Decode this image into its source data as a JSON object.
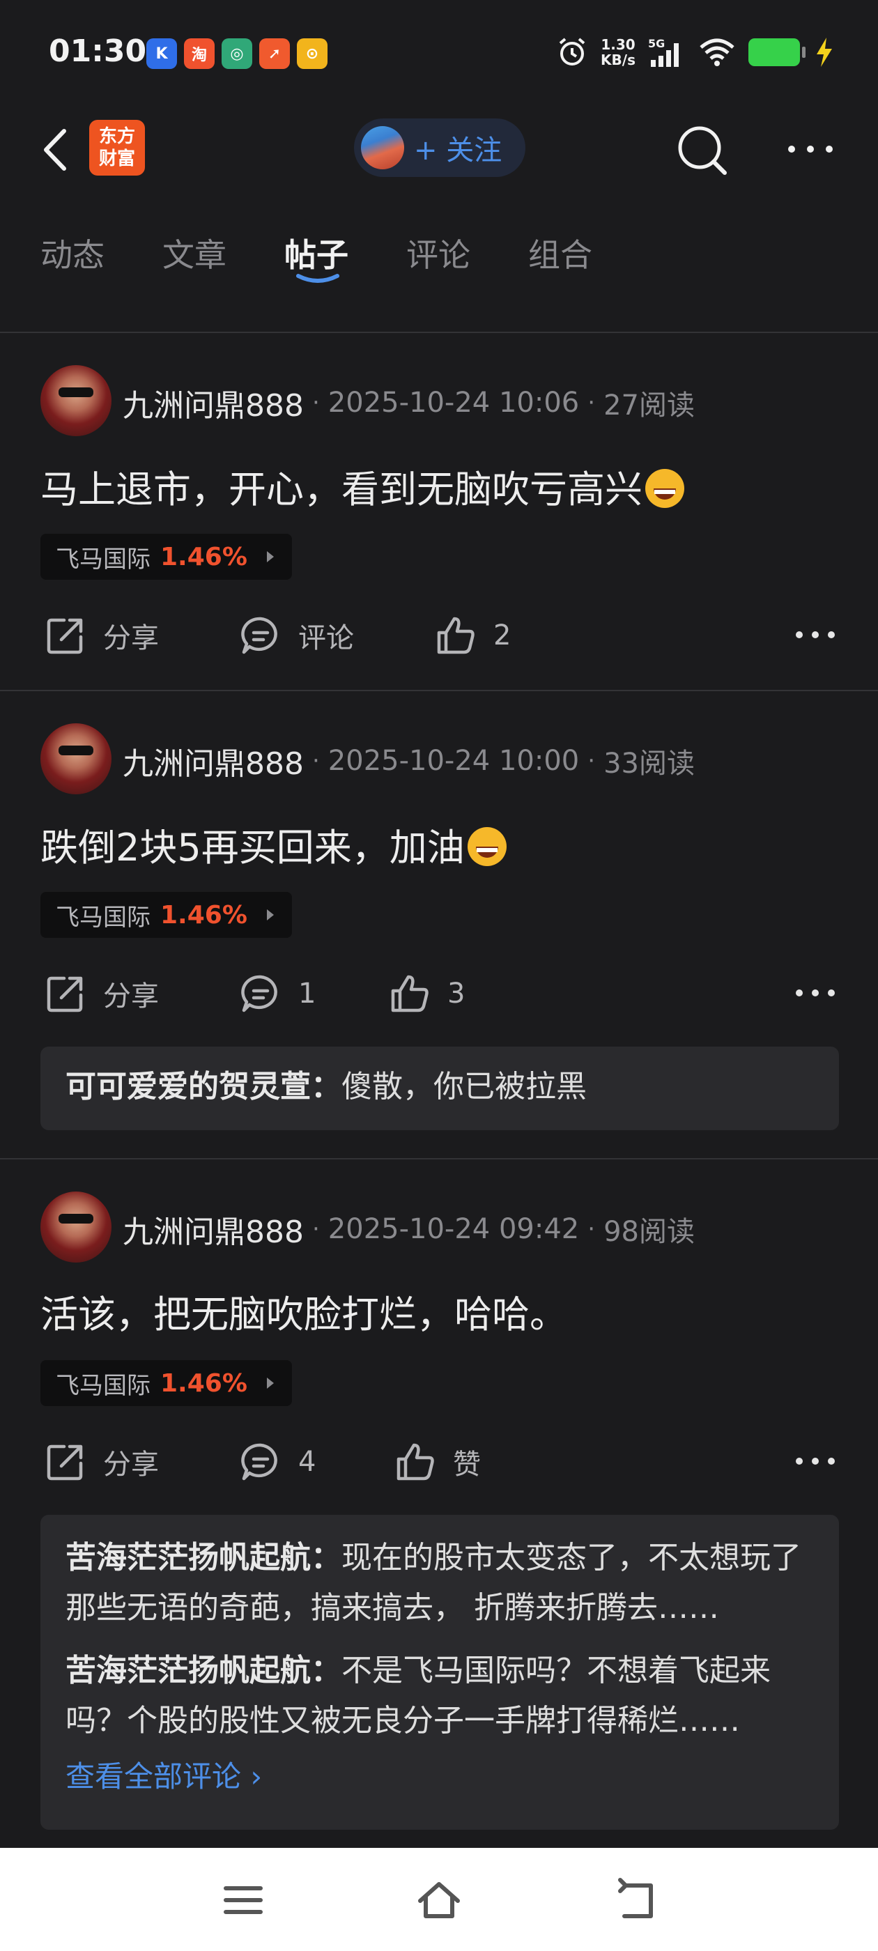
{
  "status_bar": {
    "time": "01:30",
    "net_speed_value": "1.30",
    "net_speed_unit": "KB/s",
    "network": "5G",
    "apps": [
      {
        "icon": "k-app-icon",
        "glyph": "K",
        "color": "#2f6ee8"
      },
      {
        "icon": "taobao-icon",
        "glyph": "淘",
        "color": "#f0522e"
      },
      {
        "icon": "green-app-icon",
        "glyph": "◎",
        "color": "#30a878"
      },
      {
        "icon": "red-app-icon",
        "glyph": "➚",
        "color": "#f05a2e"
      },
      {
        "icon": "yellow-app-icon",
        "glyph": "⊙",
        "color": "#f2b41c"
      }
    ]
  },
  "header": {
    "logo_line1": "东方",
    "logo_line2": "财富",
    "follow_label": "+ 关注"
  },
  "tabs": [
    {
      "label": "动态",
      "active": false
    },
    {
      "label": "文章",
      "active": false
    },
    {
      "label": "帖子",
      "active": true
    },
    {
      "label": "评论",
      "active": false
    },
    {
      "label": "组合",
      "active": false
    }
  ],
  "posts": [
    {
      "username": "九洲问鼎888",
      "time": "2025-10-24 10:06",
      "reads": "27阅读",
      "text": "马上退市，开心，看到无脑吹亏高兴",
      "emoji": "laughing-emoji",
      "stock_name": "飞马国际",
      "stock_change": "1.46%",
      "share_label": "分享",
      "comment_label": "评论",
      "like_label": "2"
    },
    {
      "username": "九洲问鼎888",
      "time": "2025-10-24 10:00",
      "reads": "33阅读",
      "text": "跌倒2块5再买回来，加油",
      "emoji": "grinning-emoji",
      "stock_name": "飞马国际",
      "stock_change": "1.46%",
      "share_label": "分享",
      "comment_label": "1",
      "like_label": "3",
      "comments": [
        {
          "author": "可可爱爱的贺灵萱",
          "text": "傻散，你已被拉黑"
        }
      ]
    },
    {
      "username": "九洲问鼎888",
      "time": "2025-10-24 09:42",
      "reads": "98阅读",
      "text": "活该，把无脑吹脸打烂，哈哈。",
      "stock_name": "飞马国际",
      "stock_change": "1.46%",
      "share_label": "分享",
      "comment_label": "4",
      "like_label": "赞",
      "comments": [
        {
          "author": "苦海茫茫扬帆起航",
          "text": "现在的股市太变态了，不太想玩了那些无语的奇葩，搞来搞去，  折腾来折腾去……"
        },
        {
          "author": "苦海茫茫扬帆起航",
          "text": "不是飞马国际吗？不想着飞起来吗？个股的股性又被无良分子一手牌打得稀烂……"
        }
      ],
      "see_all": "查看全部评论 ›"
    }
  ]
}
